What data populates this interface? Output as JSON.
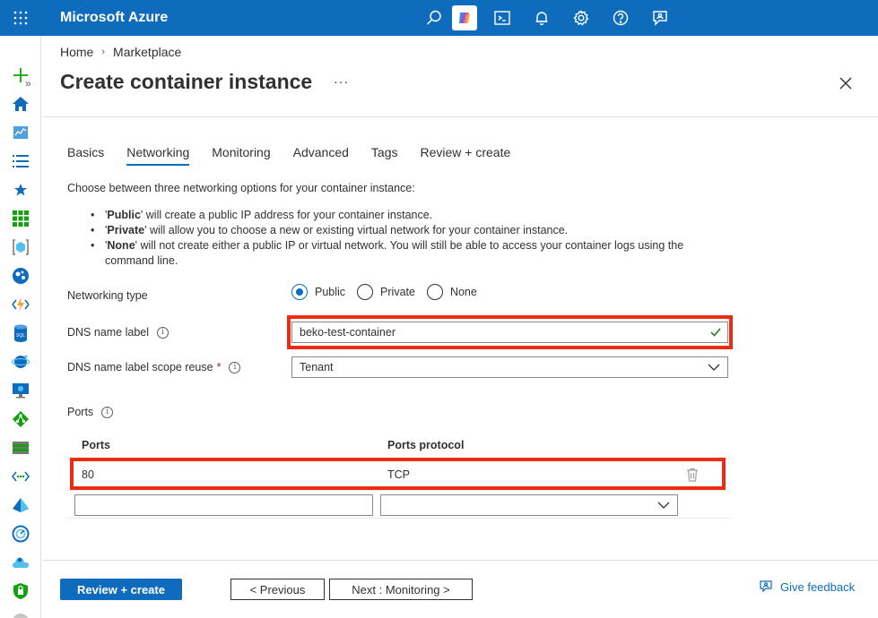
{
  "topbar": {
    "brand": "Microsoft Azure",
    "bg_color": "#0f6cbd",
    "icons": [
      "search-icon",
      "copilot-icon",
      "cloud-shell-icon",
      "notifications-icon",
      "settings-icon",
      "help-icon",
      "feedback-icon"
    ]
  },
  "leftnav": {
    "expand_label": "»",
    "icons": [
      "create-resource-icon",
      "home-icon",
      "dashboard-icon",
      "all-services-icon",
      "favorites-icon",
      "all-resources-icon",
      "resource-groups-icon",
      "app-services-icon",
      "function-apps-icon",
      "sql-databases-icon",
      "cosmos-db-icon",
      "virtual-machines-icon",
      "load-balancers-icon",
      "storage-accounts-icon",
      "virtual-networks-icon",
      "entra-id-icon",
      "monitor-icon",
      "advisor-icon",
      "defender-icon"
    ]
  },
  "breadcrumb": {
    "home": "Home",
    "sep": "›",
    "marketplace": "Marketplace"
  },
  "page": {
    "title": "Create container instance",
    "more": "···"
  },
  "tabs": [
    {
      "label": "Basics",
      "active": false
    },
    {
      "label": "Networking",
      "active": true
    },
    {
      "label": "Monitoring",
      "active": false
    },
    {
      "label": "Advanced",
      "active": false
    },
    {
      "label": "Tags",
      "active": false
    },
    {
      "label": "Review + create",
      "active": false
    }
  ],
  "intro": "Choose between three networking options for your container instance:",
  "bullets": [
    {
      "bold": "Public",
      "pre": "'",
      "post": "' will create a public IP address for your container instance."
    },
    {
      "bold": "Private",
      "pre": "'",
      "post": "' will allow you to choose a new or existing virtual network for your container instance."
    },
    {
      "bold": "None",
      "pre": "'",
      "post": "' will not create either a public IP or virtual network. You will still be able to access your container logs using the command line."
    }
  ],
  "networking_type": {
    "label": "Networking type",
    "options": [
      "Public",
      "Private",
      "None"
    ],
    "selected": "Public"
  },
  "dns": {
    "label": "DNS name label",
    "info": "i",
    "value": "beko-test-container",
    "valid_icon": "checkmark-icon"
  },
  "scope_reuse": {
    "label": "DNS name label scope reuse",
    "required_marker": "*",
    "info": "i",
    "value": "Tenant"
  },
  "ports": {
    "label": "Ports",
    "info": "i",
    "col_ports": "Ports",
    "col_protocol": "Ports protocol",
    "rows": [
      {
        "port": "80",
        "protocol": "TCP"
      }
    ],
    "new_port_value": "",
    "new_protocol_value": ""
  },
  "footer": {
    "review_create": "Review + create",
    "previous": "< Previous",
    "next": "Next : Monitoring >",
    "give_feedback": "Give feedback"
  },
  "colors": {
    "accent": "#0f6cbd",
    "highlight": "#ea2d12",
    "valid": "#107c10"
  }
}
